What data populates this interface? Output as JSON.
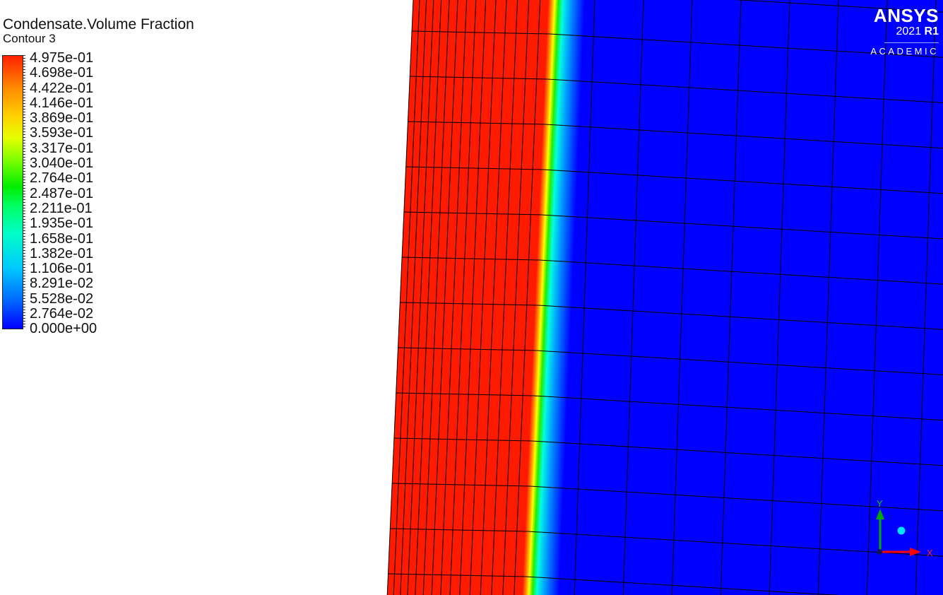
{
  "legend": {
    "title": "Condensate.Volume Fraction",
    "subtitle": "Contour 3",
    "labels": [
      "4.975e-01",
      "4.698e-01",
      "4.422e-01",
      "4.146e-01",
      "3.869e-01",
      "3.593e-01",
      "3.317e-01",
      "3.040e-01",
      "2.764e-01",
      "2.487e-01",
      "2.211e-01",
      "1.935e-01",
      "1.658e-01",
      "1.382e-01",
      "1.106e-01",
      "8.291e-02",
      "5.528e-02",
      "2.764e-02",
      "0.000e+00"
    ]
  },
  "logo": {
    "brand": "ANSYS",
    "version": "2021",
    "release": "R1",
    "edition": "ACADEMIC"
  },
  "triad": {
    "x_label": "X",
    "y_label": "Y"
  },
  "colors": {
    "high": "#ff0000",
    "low": "#0000ff",
    "x_axis": "#ff0000",
    "y_axis": "#00aa00",
    "origin_ball": "#00e5ff"
  }
}
